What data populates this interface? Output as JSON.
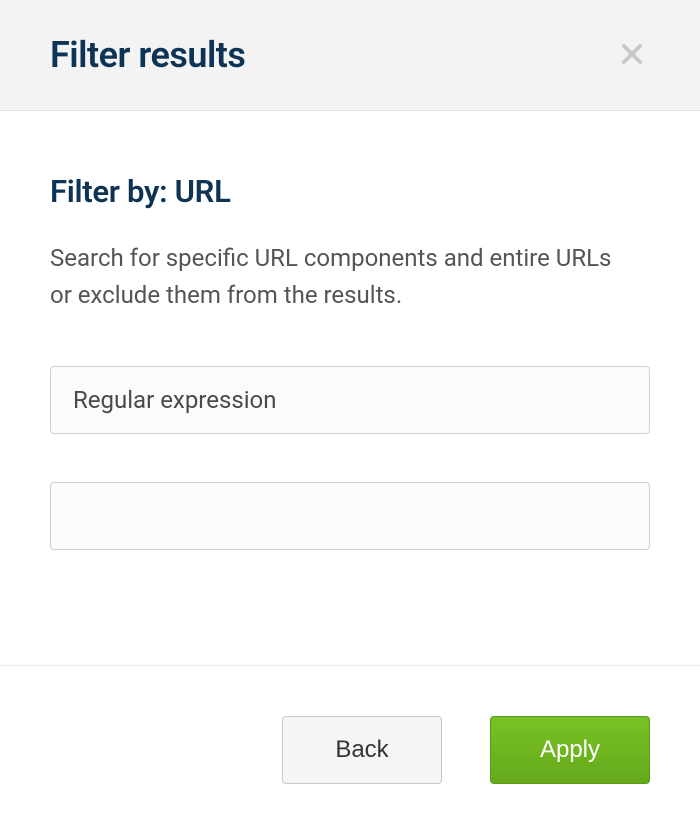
{
  "header": {
    "title": "Filter results"
  },
  "main": {
    "section_title": "Filter by: URL",
    "description": "Search for specific URL components and entire URLs or exclude them from the results.",
    "mode_select": {
      "selected": "Regular expression"
    },
    "value_input": {
      "value": ""
    }
  },
  "footer": {
    "back_label": "Back",
    "apply_label": "Apply"
  }
}
